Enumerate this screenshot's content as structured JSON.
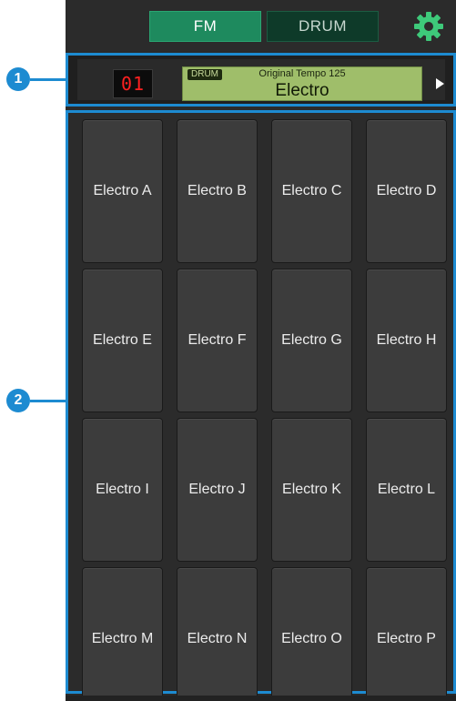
{
  "mode_tabs": {
    "fm_label": "FM",
    "drum_label": "DRUM",
    "active": "FM"
  },
  "header": {
    "pattern_number": "01",
    "tag": "DRUM",
    "subtitle": "Original Tempo 125",
    "name": "Electro"
  },
  "pads": [
    "Electro A",
    "Electro B",
    "Electro C",
    "Electro D",
    "Electro E",
    "Electro F",
    "Electro G",
    "Electro H",
    "Electro I",
    "Electro J",
    "Electro K",
    "Electro L",
    "Electro M",
    "Electro N",
    "Electro O",
    "Electro P"
  ],
  "callouts": [
    "1",
    "2"
  ],
  "colors": {
    "accent": "#1d8bd1",
    "fm_active": "#1e8a5e",
    "drum_inactive": "#0e3a29",
    "gear": "#3ec97a",
    "lcd": "#9fbe6a",
    "led_digits": "#ff2020"
  },
  "icons": {
    "settings": "gear-icon",
    "next": "triangle-right-icon"
  }
}
